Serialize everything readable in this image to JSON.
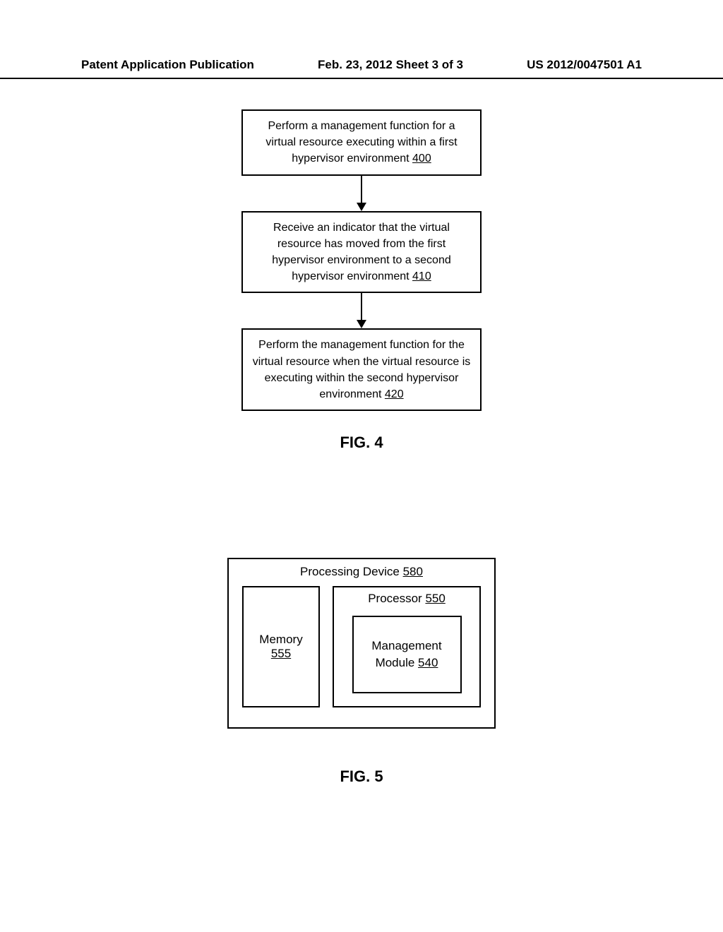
{
  "header": {
    "left": "Patent Application Publication",
    "center": "Feb. 23, 2012  Sheet 3 of 3",
    "right": "US 2012/0047501 A1"
  },
  "fig4": {
    "box1_text": "Perform a management function for a virtual resource executing within a first hypervisor environment ",
    "box1_ref": "400",
    "box2_text": "Receive an indicator that the virtual resource has moved from the first hypervisor environment to a second hypervisor environment ",
    "box2_ref": "410",
    "box3_text": "Perform the management function for the virtual resource when the virtual resource is executing within the second hypervisor environment ",
    "box3_ref": "420",
    "label": "FIG. 4"
  },
  "fig5": {
    "device_label": "Processing Device ",
    "device_ref": "580",
    "memory_label": "Memory",
    "memory_ref": "555",
    "processor_label": "Processor ",
    "processor_ref": "550",
    "mgmt_line1": "Management",
    "mgmt_line2": "Module ",
    "mgmt_ref": "540",
    "label": "FIG. 5"
  }
}
